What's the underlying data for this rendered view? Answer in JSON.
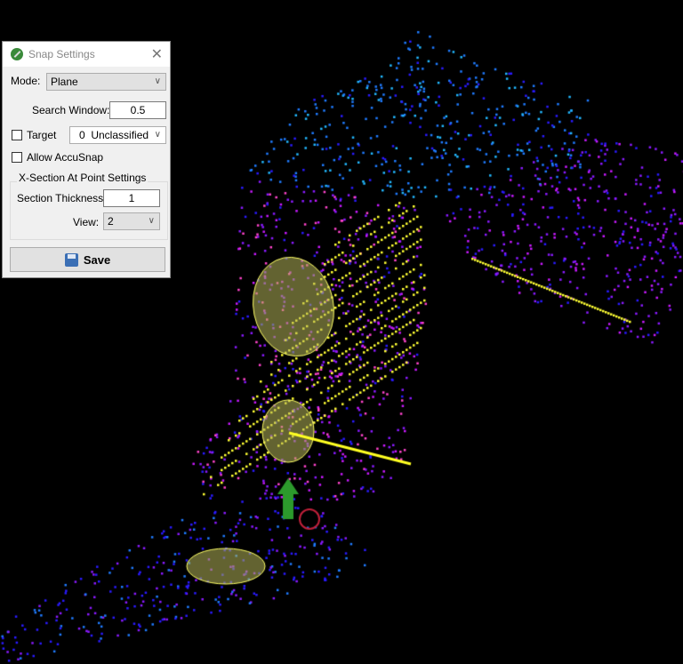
{
  "dialog": {
    "title": "Snap Settings",
    "icons": {
      "app": "app-leaf-icon",
      "close": "close-icon",
      "save": "floppy-disk-icon"
    },
    "mode_label": "Mode:",
    "mode_value": "Plane",
    "search_window_label": "Search Window:",
    "search_window_value": "0.5",
    "target_label": "Target",
    "target_checked": false,
    "target_class_value": "0  Unclassified",
    "allow_accusnap_label": "Allow AccuSnap",
    "allow_accusnap_checked": false,
    "xsection_group_label": "X-Section At Point Settings",
    "section_thickness_label": "Section Thickness:",
    "section_thickness_value": "1",
    "view_label": "View:",
    "view_value": "2",
    "save_label": "Save"
  },
  "viewport": {
    "background": "#000000",
    "point_colors": [
      "#2a1aff",
      "#1f7bff",
      "#22b8ff",
      "#8a1aff",
      "#c91aff",
      "#ff44cc",
      "#ffff33"
    ],
    "highlight_color": "#ffff66"
  }
}
